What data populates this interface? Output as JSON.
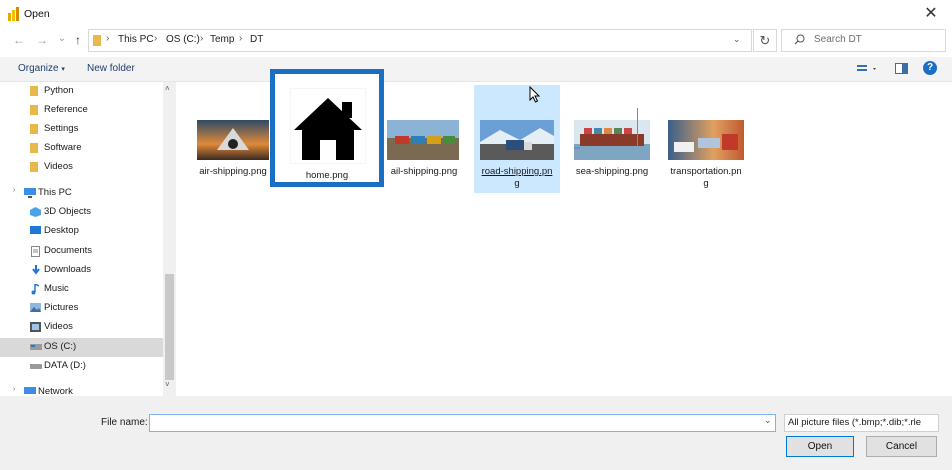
{
  "window": {
    "title": "Open",
    "close_glyph": "✕"
  },
  "nav": {
    "back_glyph": "←",
    "forward_glyph": "→",
    "recent_glyph": "⌄",
    "up_glyph": "↑",
    "breadcrumbs": [
      "This PC",
      "OS (C:)",
      "Temp",
      "DT"
    ],
    "refresh_glyph": "↻",
    "search_placeholder": "Search DT"
  },
  "toolbar": {
    "organize_label": "Organize",
    "new_folder_label": "New folder",
    "help_glyph": "?"
  },
  "sidebar": {
    "items": [
      {
        "label": "Python",
        "icon": "folder-icon"
      },
      {
        "label": "Reference",
        "icon": "folder-icon"
      },
      {
        "label": "Settings",
        "icon": "folder-icon"
      },
      {
        "label": "Software",
        "icon": "folder-icon"
      },
      {
        "label": "Videos",
        "icon": "folder-icon"
      },
      {
        "label": "This PC",
        "icon": "computer-icon"
      },
      {
        "label": "3D Objects",
        "icon": "cube-icon"
      },
      {
        "label": "Desktop",
        "icon": "desktop-icon"
      },
      {
        "label": "Documents",
        "icon": "document-icon"
      },
      {
        "label": "Downloads",
        "icon": "download-icon"
      },
      {
        "label": "Music",
        "icon": "music-icon"
      },
      {
        "label": "Pictures",
        "icon": "pictures-icon"
      },
      {
        "label": "Videos",
        "icon": "video-icon"
      },
      {
        "label": "OS (C:)",
        "icon": "drive-icon",
        "selected": true
      },
      {
        "label": "DATA (D:)",
        "icon": "drive-icon"
      },
      {
        "label": "Network",
        "icon": "network-icon"
      }
    ]
  },
  "files": [
    {
      "name": "air-shipping.png",
      "line1": "air-shipping.png",
      "line2": ""
    },
    {
      "name": "home.png",
      "line1": "home.png",
      "line2": ""
    },
    {
      "name": "rail-shipping.png",
      "line1": "ail-shipping.png",
      "line2": ""
    },
    {
      "name": "road-shipping.png",
      "line1": "road-shipping.pn",
      "line2": "g",
      "selected": true
    },
    {
      "name": "sea-shipping.png",
      "line1": "sea-shipping.png",
      "line2": ""
    },
    {
      "name": "transportation.png",
      "line1": "transportation.pn",
      "line2": "g"
    }
  ],
  "footer": {
    "file_name_label": "File name:",
    "file_name_value": "",
    "filter_value": "All picture files (*.bmp;*.dib;*.rle",
    "open_label": "Open",
    "cancel_label": "Cancel"
  },
  "colors": {
    "highlight_border": "#1a6fc4",
    "selection": "#cce8ff",
    "folder": "#e8b84a"
  }
}
